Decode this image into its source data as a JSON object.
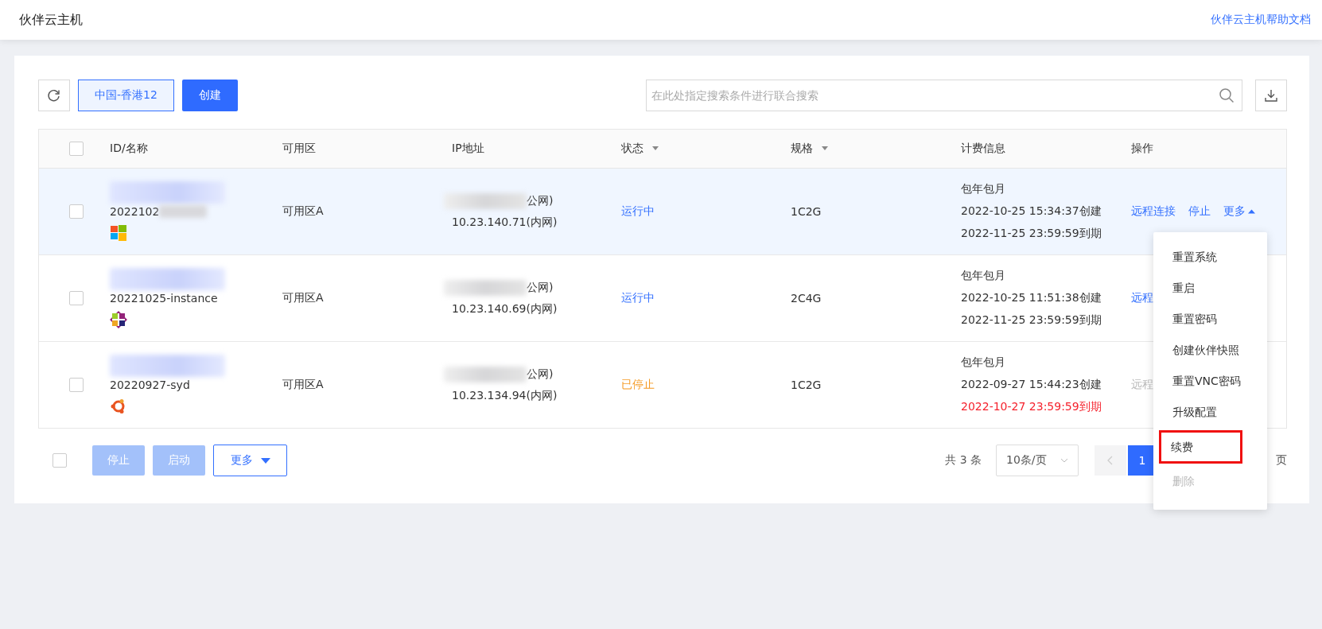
{
  "header": {
    "title": "伙伴云主机",
    "help_link": "伙伴云主机帮助文档"
  },
  "toolbar": {
    "region": "中国-香港12",
    "create": "创建",
    "search": {
      "placeholder": "在此处指定搜索条件进行联合搜索"
    }
  },
  "table": {
    "select_all": {
      "checked": false
    },
    "columns": [
      {
        "label": "ID/名称",
        "sortable": false
      },
      {
        "label": "可用区",
        "sortable": false
      },
      {
        "label": "IP地址",
        "sortable": false
      },
      {
        "label": "状态",
        "sortable": true
      },
      {
        "label": "规格",
        "sortable": true
      },
      {
        "label": "计费信息",
        "sortable": false
      },
      {
        "label": "操作",
        "sortable": false
      }
    ],
    "rows": [
      {
        "checked": false,
        "highlighted": true,
        "name": "2022102",
        "kind": "windows",
        "zone": "可用区A",
        "public_ip": "公网)",
        "private_ip": "10.23.140.71(内网)",
        "status": "运行中",
        "stopped": false,
        "spec": "1C2G",
        "billing": "包年包月",
        "created": "2022-10-25 15:34:37创建",
        "expires": "2022-11-25 23:59:59到期",
        "expired": false,
        "actions": [
          {
            "label": "远程连接",
            "kind": "link",
            "disabled": false
          },
          {
            "label": "停止",
            "kind": "link",
            "disabled": false
          },
          {
            "label": "更多",
            "kind": "dropdown",
            "expanded": true
          }
        ]
      },
      {
        "checked": false,
        "highlighted": false,
        "name": "20221025-instance",
        "kind": "centos",
        "zone": "可用区A",
        "public_ip": "公网)",
        "private_ip": "10.23.140.69(内网)",
        "status": "运行中",
        "stopped": false,
        "spec": "2C4G",
        "billing": "包年包月",
        "created": "2022-10-25 11:51:38创建",
        "expires": "2022-11-25 23:59:59到期",
        "expired": false,
        "actions": [
          {
            "label": "远程",
            "kind": "link",
            "disabled": false
          }
        ]
      },
      {
        "checked": false,
        "highlighted": false,
        "name": "20220927-syd",
        "kind": "ubuntu",
        "zone": "可用区A",
        "public_ip": "公网)",
        "private_ip": "10.23.134.94(内网)",
        "status": "已停止",
        "stopped": true,
        "spec": "1C2G",
        "billing": "包年包月",
        "created": "2022-09-27 15:44:23创建",
        "expires": "2022-10-27 23:59:59到期",
        "expired": true,
        "actions": [
          {
            "label": "远程",
            "kind": "link",
            "disabled": true
          }
        ]
      }
    ]
  },
  "bulk": {
    "select_all": {
      "checked": false
    },
    "buttons": [
      {
        "label": "停止",
        "kind": "primary",
        "disabled": true
      },
      {
        "label": "启动",
        "kind": "primary",
        "disabled": true
      },
      {
        "label": "更多",
        "kind": "dropdown"
      }
    ]
  },
  "pagination": {
    "total": "共 3 条",
    "page_size": "10条/页",
    "pages": [
      {
        "label": "1",
        "selected": true
      }
    ],
    "suffix": "页"
  },
  "more_menu": {
    "items": [
      {
        "label": "重置系统",
        "disabled": false,
        "highlighted": false
      },
      {
        "label": "重启",
        "disabled": false,
        "highlighted": false
      },
      {
        "label": "重置密码",
        "disabled": false,
        "highlighted": false
      },
      {
        "label": "创建伙伴快照",
        "disabled": false,
        "highlighted": false
      },
      {
        "label": "重置VNC密码",
        "disabled": false,
        "highlighted": false
      },
      {
        "label": "升级配置",
        "disabled": false,
        "highlighted": false
      },
      {
        "label": "续费",
        "disabled": false,
        "highlighted": true
      },
      {
        "label": "删除",
        "disabled": true,
        "highlighted": false
      }
    ]
  }
}
